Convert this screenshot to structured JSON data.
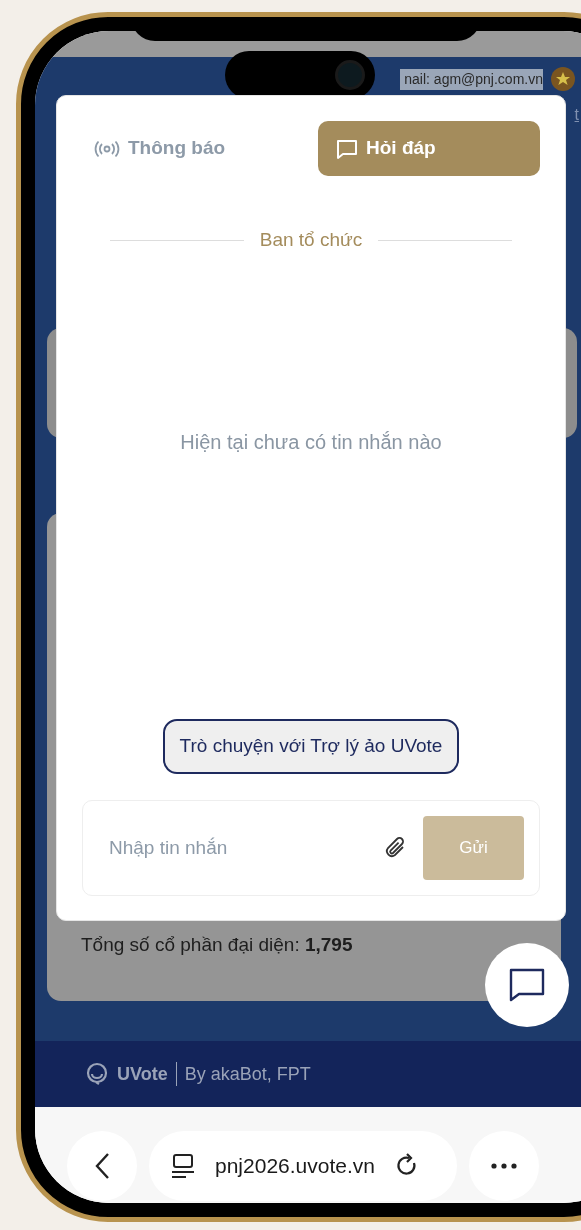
{
  "header": {
    "email": "nail: agm@pnj.com.vn",
    "link": "t"
  },
  "modal": {
    "tabs": [
      {
        "label": "Thông báo",
        "selected": false
      },
      {
        "label": "Hỏi đáp",
        "selected": true
      }
    ],
    "section_title": "Ban tổ chức",
    "empty_message": "Hiện tại chưa có tin nhắn nào",
    "assistant_button": "Trò chuyện với Trợ lý ảo UVote",
    "input": {
      "placeholder": "Nhập tin nhắn"
    },
    "send_button": {
      "label": "Gửi",
      "disabled": true
    }
  },
  "summary": "Tổng số cổ phần đại diện: **1,795**",
  "footer": {
    "brand": "UVote",
    "credit": "By akaBot, FPT"
  },
  "browser": {
    "url": "pnj2026.uvote.vn"
  }
}
